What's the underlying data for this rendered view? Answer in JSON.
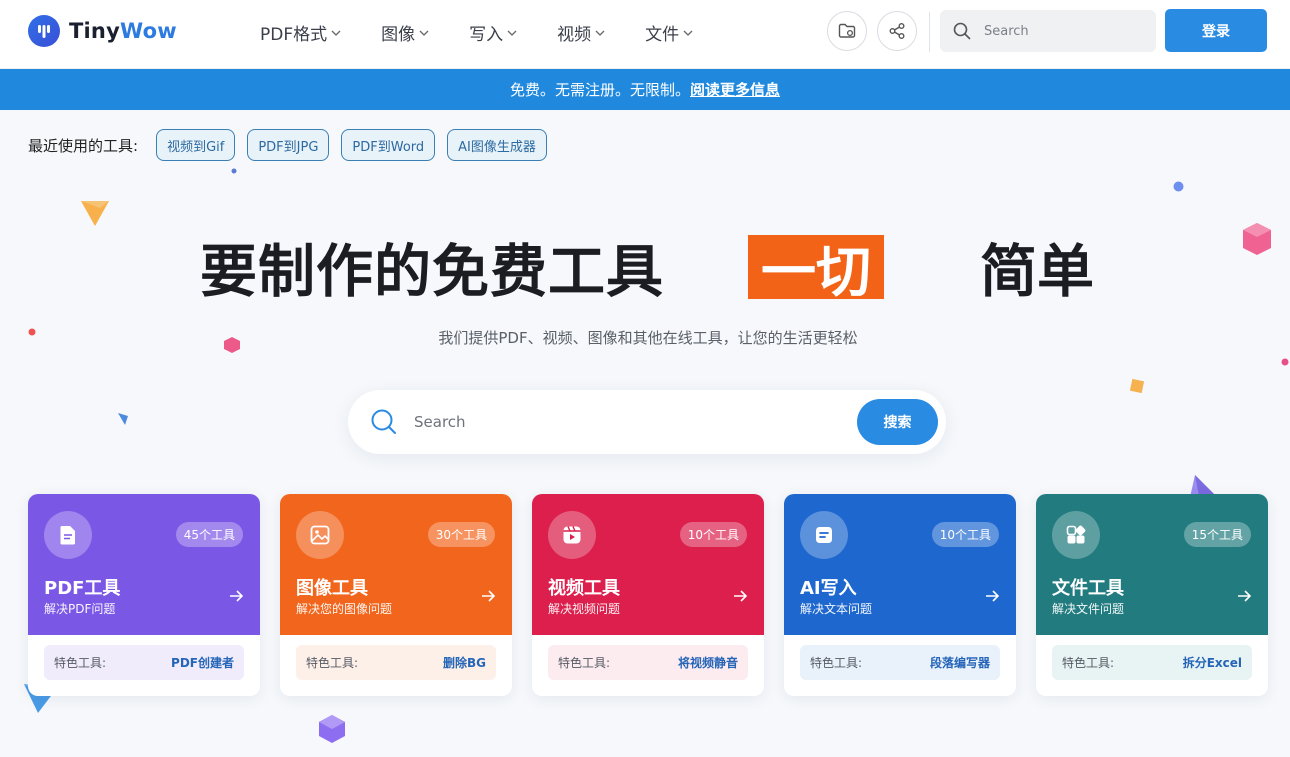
{
  "header": {
    "logo": {
      "text_main": "Tiny",
      "text_accent": "Wow"
    },
    "nav": [
      {
        "label": "PDF格式"
      },
      {
        "label": "图像"
      },
      {
        "label": "写入"
      },
      {
        "label": "视频"
      },
      {
        "label": "文件"
      }
    ],
    "search_placeholder": "Search",
    "login_label": "登录"
  },
  "banner": {
    "text": "免费。无需注册。无限制。",
    "link": "阅读更多信息"
  },
  "recent": {
    "label": "最近使用的工具:",
    "chips": [
      "视频到Gif",
      "PDF到JPG",
      "PDF到Word",
      "AI图像生成器"
    ]
  },
  "hero": {
    "title": "要制作的免费工具",
    "highlight": "一切",
    "title_end": "简单",
    "subtitle": "我们提供PDF、视频、图像和其他在线工具，让您的生活更轻松",
    "search_placeholder": "Search",
    "search_button": "搜索"
  },
  "cards": [
    {
      "title": "PDF工具",
      "desc": "解决PDF问题",
      "count": "45个工具",
      "feature_label": "特色工具:",
      "feature_link": "PDF创建者",
      "color": "#7b57e6",
      "feature_bg": "#f1ecfc"
    },
    {
      "title": "图像工具",
      "desc": "解决您的图像问题",
      "count": "30个工具",
      "feature_label": "特色工具:",
      "feature_link": "删除BG",
      "color": "#f2651c",
      "feature_bg": "#fdf0e9"
    },
    {
      "title": "视频工具",
      "desc": "解决视频问题",
      "count": "10个工具",
      "feature_label": "特色工具:",
      "feature_link": "将视频静音",
      "color": "#dc1f4c",
      "feature_bg": "#fcebef"
    },
    {
      "title": "AI写入",
      "desc": "解决文本问题",
      "count": "10个工具",
      "feature_label": "特色工具:",
      "feature_link": "段落编写器",
      "color": "#1e67cf",
      "feature_bg": "#e9f1fb"
    },
    {
      "title": "文件工具",
      "desc": "解决文件问题",
      "count": "15个工具",
      "feature_label": "特色工具:",
      "feature_link": "拆分Excel",
      "color": "#217b7f",
      "feature_bg": "#e8f3f4"
    }
  ]
}
